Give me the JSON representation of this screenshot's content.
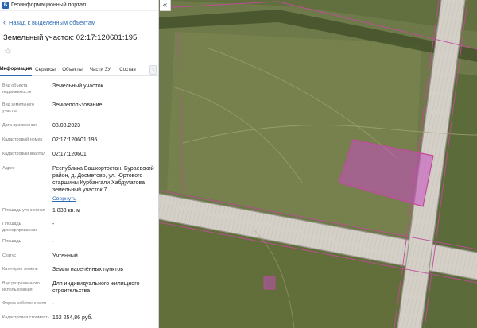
{
  "portal": {
    "title": "Геоинформационный портал",
    "logo_icon": "portal-logo-icon"
  },
  "panel": {
    "back_label": "Назад к выделенным объектам",
    "parcel_title": "Земельный участок: 02:17:120601:195",
    "favorite_icon": "star-icon",
    "tabs": [
      {
        "label": "Информация",
        "active": true
      },
      {
        "label": "Сервисы",
        "active": false
      },
      {
        "label": "Объекты",
        "active": false
      },
      {
        "label": "Части ЗУ",
        "active": false
      },
      {
        "label": "Состав",
        "active": false
      }
    ],
    "rows": [
      {
        "label": "Вид объекта недвижимости",
        "value": "Земельный участок"
      },
      {
        "label": "Вид земельного участка",
        "value": "Землепользование"
      },
      {
        "label": "Дата присвоения",
        "value": "08.08.2023"
      },
      {
        "label": "Кадастровый номер",
        "value": "02:17:120601:195"
      },
      {
        "label": "Кадастровый квартал",
        "value": "02:17:120601"
      },
      {
        "label": "Адрес",
        "value": "Республика Башкортостан, Бураевский район, д. Досметово, ул. Юртового старшины Курбангали Хабдулатова земельный участок 7",
        "link": "Свернуть"
      },
      {
        "label": "Площадь уточненная",
        "value": "1 833 кв. м"
      },
      {
        "label": "Площадь декларированная",
        "value": "-"
      },
      {
        "label": "Площадь",
        "value": "-"
      },
      {
        "label": "Статус",
        "value": "Учтенный"
      },
      {
        "label": "Категория земель",
        "value": "Земли населённых пунктов"
      },
      {
        "label": "Вид разрешенного использования",
        "value": "Для индивидуального жилищного строительства"
      },
      {
        "label": "Форма собственности",
        "value": "-"
      },
      {
        "label": "Кадастровая стоимость",
        "value": "162 254,86 руб."
      }
    ]
  },
  "map": {
    "collapse_icon": "double-chevron-left-icon",
    "colors": {
      "field": "#6f7a4a",
      "field_dark": "#4f5a34",
      "road": "#d4d0c8",
      "road_edge": "#9a968e",
      "boundary": "#c24a9a",
      "parcel_fill": "#c64bc0"
    }
  }
}
